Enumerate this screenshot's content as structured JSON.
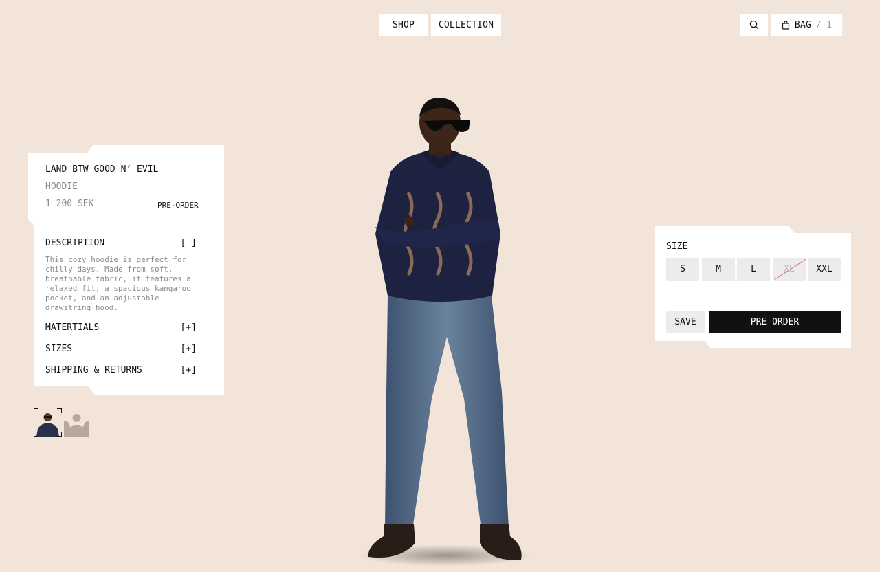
{
  "nav": {
    "shop_label": "SHOP",
    "collection_label": "COLLECTION",
    "bag_label": "BAG",
    "bag_separator": "/",
    "bag_count": "1"
  },
  "product": {
    "name": "LAND BTW GOOD N’ EVIL",
    "type": "HOODIE",
    "price": "1 200 SEK",
    "status": "PRE-ORDER"
  },
  "accordion": [
    {
      "label": "DESCRIPTION",
      "toggle": "[–]"
    },
    {
      "label": "MATERTIALS",
      "toggle": "[+]"
    },
    {
      "label": "SIZES",
      "toggle": "[+]"
    },
    {
      "label": "SHIPPING & RETURNS",
      "toggle": "[+]"
    }
  ],
  "description": "This cozy hoodie is perfect for chilly days. Made from soft, breathable fabric, it features a relaxed fit, a spacious kangaroo pocket, and an adjustable drawstring hood.",
  "size_picker": {
    "label": "SIZE",
    "sizes": [
      "S",
      "M",
      "L",
      "XL",
      "XXL"
    ],
    "unavailable": [
      "XL"
    ]
  },
  "actions": {
    "save_label": "SAVE",
    "preorder_label": "PRE-ORDER"
  },
  "colors": {
    "background": "#f2e4d9",
    "panel": "#ffffff",
    "primary_button": "#111111",
    "size_button": "#ececec",
    "muted_text": "#8a8a8a",
    "strike": "#e06b6b"
  },
  "icons": [
    "search-icon",
    "bag-icon"
  ]
}
